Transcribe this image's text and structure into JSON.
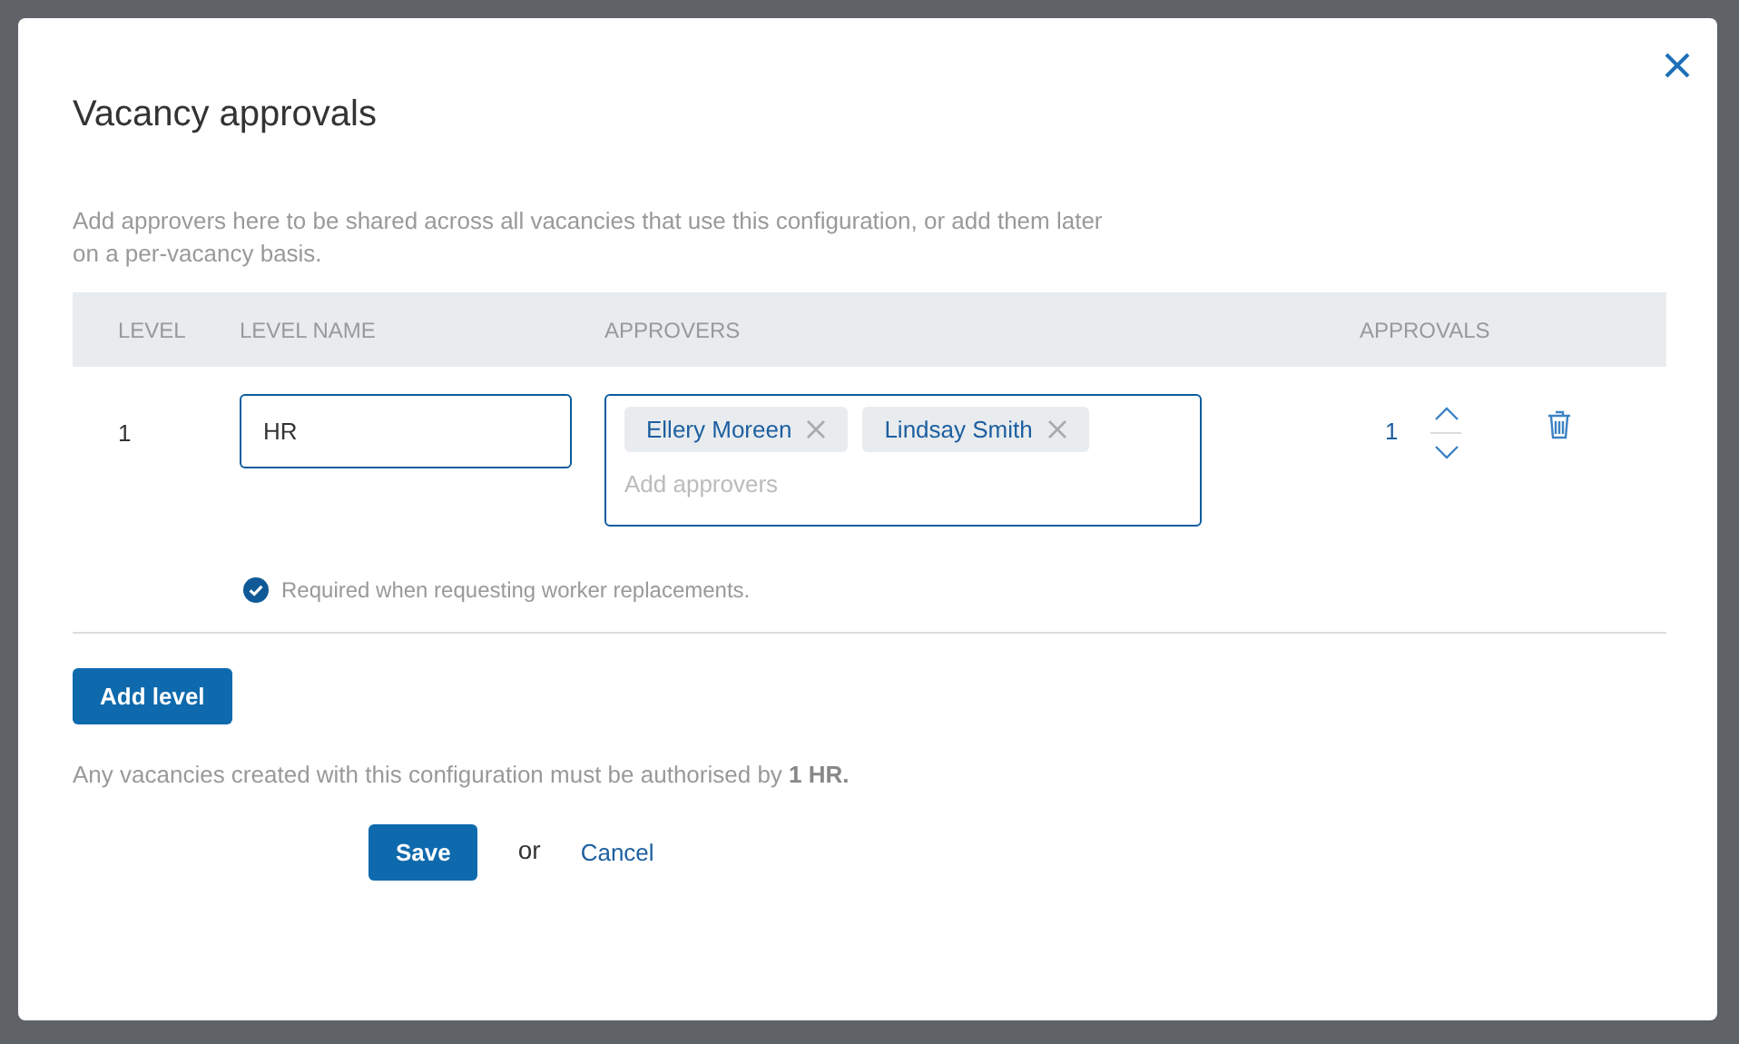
{
  "dialog": {
    "title": "Vacancy approvals",
    "description": "Add approvers here to be shared across all vacancies that use this configuration, or add them later on a per-vacancy basis."
  },
  "table": {
    "columns": [
      "LEVEL",
      "LEVEL NAME",
      "APPROVERS",
      "APPROVALS"
    ],
    "rows": [
      {
        "level": "1",
        "name": "HR",
        "approvers": [
          "Ellery Moreen",
          "Lindsay Smith"
        ],
        "approvers_placeholder": "Add approvers",
        "approvals": "1",
        "required": {
          "checked": true,
          "label": "Required when requesting worker replacements."
        }
      }
    ]
  },
  "add_level_button": "Add level",
  "summary": "Any vacancies created with this configuration must be authorised by **1 HR.**",
  "footer": {
    "save": "Save",
    "or": "or",
    "cancel": "Cancel"
  }
}
